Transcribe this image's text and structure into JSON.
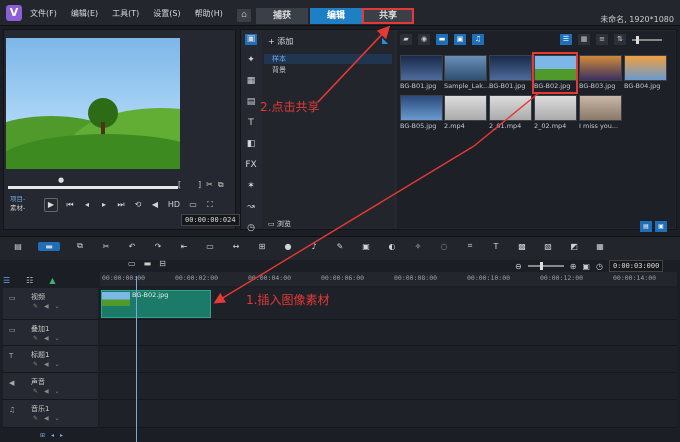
{
  "menu": {
    "file": "文件(F)",
    "edit": "编辑(E)",
    "tools": "工具(T)",
    "settings": "设置(S)",
    "help": "帮助(H)"
  },
  "tabs": {
    "capture": "捕获",
    "edit": "编辑",
    "share": "共享"
  },
  "project_info": "未命名, 1920*1080",
  "preview": {
    "project_label": "项目-",
    "clip_label": "素材-",
    "hd_label": "HD",
    "timecode": "00:00:00:024"
  },
  "library": {
    "add_label": "添加",
    "folders": [
      "样本",
      "背景"
    ],
    "browse_label": "浏览",
    "thumbnails": [
      {
        "label": "BG-B01.jpg"
      },
      {
        "label": "Sample_Lak..."
      },
      {
        "label": "BG-B01.jpg"
      },
      {
        "label": "BG-B02.jpg"
      },
      {
        "label": "BG-B03.jpg"
      },
      {
        "label": "BG-B04.jpg"
      },
      {
        "label": "BG-B05.jpg"
      },
      {
        "label": "2.mp4"
      },
      {
        "label": "2_01.mp4"
      },
      {
        "label": "2_02.mp4"
      },
      {
        "label": "I miss you..."
      }
    ]
  },
  "timeline": {
    "zoom_timecode": "0:00:03:000",
    "ruler": [
      "00:00:00:00",
      "00:00:02:00",
      "00:00:04:00",
      "00:00:06:00",
      "00:00:08:00",
      "00:00:10:00",
      "00:00:12:00",
      "00:00:14:00"
    ],
    "tracks": [
      {
        "name": "视频"
      },
      {
        "name": "叠加1"
      },
      {
        "name": "标题1"
      },
      {
        "name": "声音"
      },
      {
        "name": "音乐1"
      }
    ],
    "clip_label": "BG-B02.jpg"
  },
  "annotations": {
    "step2": "2.点击共享",
    "step1": "1.插入图像素材"
  },
  "colors": {
    "accent": "#1f7fc4",
    "highlight": "#e53935",
    "clip": "#1c7a68"
  }
}
